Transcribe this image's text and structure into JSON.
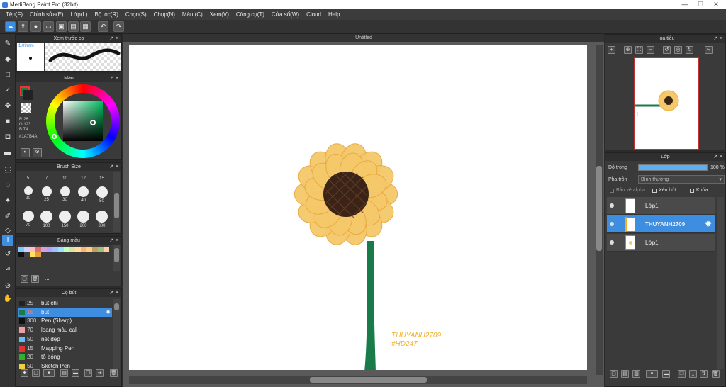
{
  "window": {
    "title": "MediBang Paint Pro (32bit)"
  },
  "menu": [
    "Tệp(F)",
    "Chỉnh sửa(E)",
    "Lớp(L)",
    "Bộ lọc(R)",
    "Chọn(S)",
    "Chụp(N)",
    "Màu (C)",
    "Xem(V)",
    "Công cụ(T)",
    "Cửa sổ(W)",
    "Cloud",
    "Help"
  ],
  "toolbar_icons": [
    "cloud-icon",
    "export-icon",
    "chat-icon",
    "comment-icon",
    "save-icon",
    "save-as-icon",
    "grid-icon",
    "undo-icon",
    "redo-icon"
  ],
  "brush_preview": {
    "title": "Xem trước cọ",
    "size": "1.09mm"
  },
  "color_panel": {
    "title": "Màu",
    "r": "R:26",
    "g": "G:123",
    "b": "B:74",
    "hex": "#1A7B4A"
  },
  "brush_size_panel": {
    "title": "Brush Size",
    "top_row": [
      "5",
      "7",
      "10",
      "12",
      "15"
    ],
    "rows": [
      [
        "20",
        "25",
        "30",
        "40",
        "50"
      ],
      [
        "70",
        "100",
        "150",
        "200",
        "300"
      ]
    ]
  },
  "palette_panel": {
    "title": "Bảng màu",
    "colors": [
      "#7fc7ff",
      "#d0d0ff",
      "#ffc0c0",
      "#e07070",
      "#d0a0e0",
      "#b0a0ff",
      "#a0c0ff",
      "#a0e0ff",
      "#c0ffc0",
      "#e0e0a0",
      "#ffe0a0",
      "#ffb080",
      "#ffd080",
      "#c0a060",
      "#a0c080",
      "#ffd0a0",
      "#101010",
      "#404040",
      "#ffe060",
      "#e0a040"
    ],
    "more_label": "..."
  },
  "brush_panel": {
    "title": "Cọ bút",
    "items": [
      {
        "size": "25",
        "name": "bút chì",
        "color": "#222222"
      },
      {
        "size": "15",
        "name": "bút",
        "color": "#1a7b4a"
      },
      {
        "size": "300",
        "name": "Pen (Sharp)",
        "color": "#111111"
      },
      {
        "size": "70",
        "name": "loang màu cali",
        "color": "#f0a0a0"
      },
      {
        "size": "50",
        "name": "nét đẹp",
        "color": "#60c0ff"
      },
      {
        "size": "15",
        "name": "Mapping Pen",
        "color": "#e03030"
      },
      {
        "size": "20",
        "name": "tô bóng",
        "color": "#30b030"
      },
      {
        "size": "50",
        "name": "Sketch Pen",
        "color": "#f0d040"
      }
    ]
  },
  "document": {
    "tab": "Untitled",
    "signature": "THUYANH2709",
    "hashtag": "#HD247"
  },
  "navigator": {
    "title": "Hoa tiêu"
  },
  "layer_panel": {
    "title": "Lớp",
    "opacity_label": "Độ trong",
    "opacity_value": "100 %",
    "opacity_fraction": 1.0,
    "blend_label": "Pha trộn",
    "blend_value": "Bình thường",
    "protect_alpha": "Bảo vệ alpha",
    "clipping": "Xén bớt",
    "lock": "Khóa",
    "layers": [
      {
        "name": "Lớp1"
      },
      {
        "name": "THUYANH2709"
      },
      {
        "name": "Lớp1"
      }
    ]
  },
  "colors": {
    "accent": "#3d8ee0",
    "stem": "#1a7b4a",
    "petal": "#f5c96a",
    "center": "#3a2418",
    "signature": "#f0b020"
  }
}
